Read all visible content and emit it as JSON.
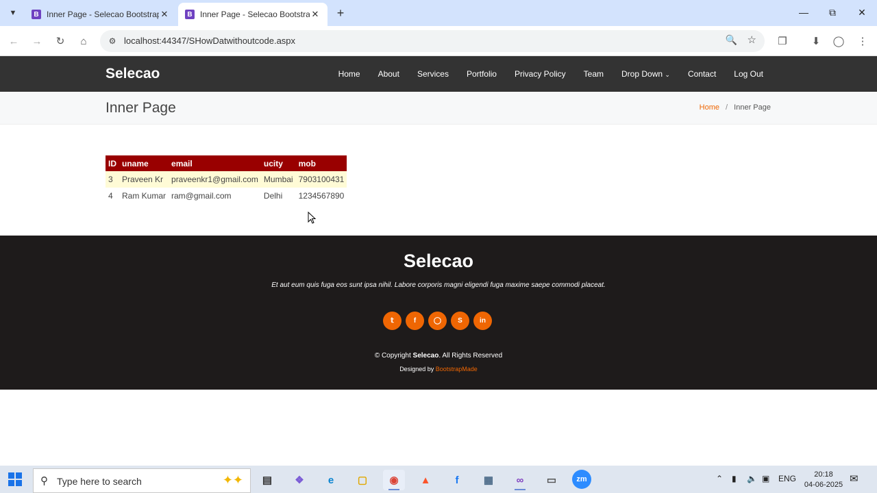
{
  "browser": {
    "tabs": [
      {
        "title": "Inner Page - Selecao Bootstrap",
        "favicon": "B",
        "active": false
      },
      {
        "title": "Inner Page - Selecao Bootstrap",
        "favicon": "B",
        "active": true
      }
    ],
    "url": "localhost:44347/SHowDatwithoutcode.aspx"
  },
  "site": {
    "logo": "Selecao",
    "nav": [
      "Home",
      "About",
      "Services",
      "Portfolio",
      "Privacy Policy",
      "Team",
      "Drop Down",
      "Contact",
      "Log Out"
    ],
    "page_title": "Inner Page",
    "breadcrumb": {
      "home": "Home",
      "separator": "/",
      "current": "Inner Page"
    }
  },
  "table": {
    "headers": [
      "ID",
      "uname",
      "email",
      "ucity",
      "mob"
    ],
    "rows": [
      [
        "3",
        "Praveen Kr",
        "praveenkr1@gmail.com",
        "Mumbai",
        "7903100431"
      ],
      [
        "4",
        "Ram Kumar",
        "ram@gmail.com",
        "Delhi",
        "1234567890"
      ]
    ],
    "header_color": "#990000",
    "alt_row_color": "#fffbd6"
  },
  "footer": {
    "logo": "Selecao",
    "description": "Et aut eum quis fuga eos sunt ipsa nihil. Labore corporis magni eligendi fuga maxime saepe commodi placeat.",
    "socials": [
      "twitter-icon",
      "facebook-icon",
      "instagram-icon",
      "skype-icon",
      "linkedin-icon"
    ],
    "copyright_prefix": "© Copyright",
    "copyright_brand": "Selecao",
    "copyright_suffix": ". All Rights Reserved",
    "credits_prefix": "Designed by",
    "credits_link": "BootstrapMade",
    "accent": "#ef6603"
  },
  "taskbar": {
    "search_placeholder": "Type here to search",
    "language": "ENG",
    "time": "20:18",
    "date": "04-06-2025"
  }
}
